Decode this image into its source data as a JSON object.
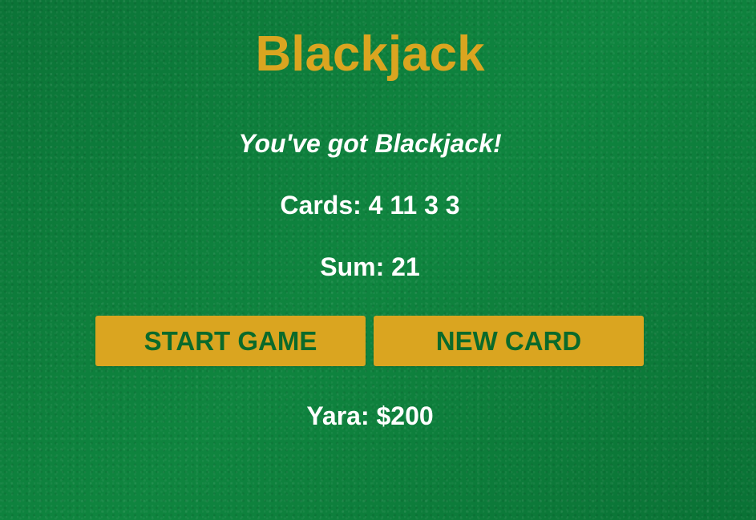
{
  "app": {
    "title": "Blackjack"
  },
  "game": {
    "message": "You've got Blackjack!",
    "cards_text": "Cards: 4 11 3 3",
    "sum_text": "Sum: 21",
    "player_text": "Yara: $200"
  },
  "buttons": {
    "start_label": "START GAME",
    "new_card_label": "NEW CARD"
  },
  "colors": {
    "background": "#0c7a3a",
    "title": "#daa520",
    "button_background": "#daa520",
    "button_text": "#0a6a2b",
    "text": "#ffffff"
  }
}
